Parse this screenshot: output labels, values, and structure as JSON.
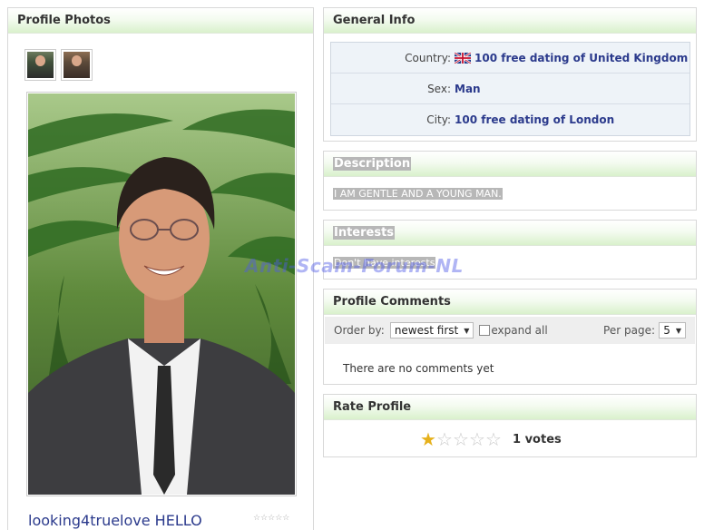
{
  "photos": {
    "title": "Profile Photos",
    "caption": "looking4truelove HELLO",
    "mini_rating_stars": "☆☆☆☆☆"
  },
  "general": {
    "title": "General Info",
    "rows": [
      {
        "label": "Country:",
        "value": "100 free dating of United Kingdom",
        "icon": "uk-flag-icon"
      },
      {
        "label": "Sex:",
        "value": "Man"
      },
      {
        "label": "City:",
        "value": "100 free dating of London"
      }
    ]
  },
  "description": {
    "title": "Description",
    "text": "I AM GENTLE AND A YOUNG MAN."
  },
  "interests": {
    "title": "Interests",
    "text": "Don't have interests"
  },
  "comments": {
    "title": "Profile Comments",
    "order_label": "Order by:",
    "order_value": "newest first",
    "expand_label": "expand all",
    "per_page_label": "Per page:",
    "per_page_value": "5",
    "empty_text": "There are no comments yet"
  },
  "rating": {
    "title": "Rate Profile",
    "stars_filled": 1,
    "stars_total": 5,
    "votes_text": "1 votes"
  },
  "watermark": "Anti-Scam-Forum-NL",
  "colors": {
    "header_gradient_end": "#d9f1cc",
    "link_blue": "#2b3a8c",
    "star_gold": "#e6b11c"
  }
}
